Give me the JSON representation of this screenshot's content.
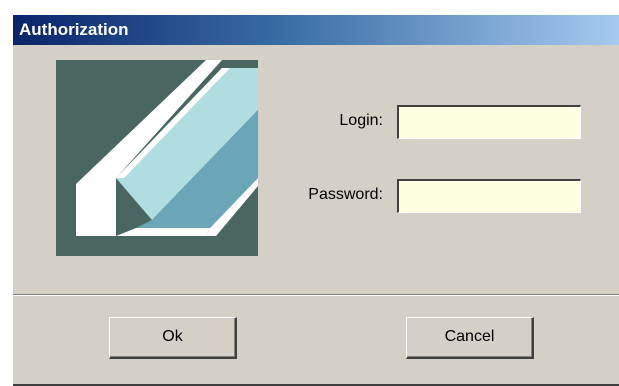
{
  "window": {
    "title": "Authorization"
  },
  "form": {
    "login_label": "Login:",
    "login_value": "",
    "password_label": "Password:",
    "password_value": ""
  },
  "buttons": {
    "ok_label": "Ok",
    "cancel_label": "Cancel"
  },
  "colors": {
    "title_gradient_start": "#0a246a",
    "title_gradient_end": "#a6caf0",
    "dialog_bg": "#d4d0c8",
    "input_bg": "#ffffe1",
    "logo_bg": "#4a6660",
    "logo_light": "#b0dee0",
    "logo_mid": "#6aa6b8"
  }
}
